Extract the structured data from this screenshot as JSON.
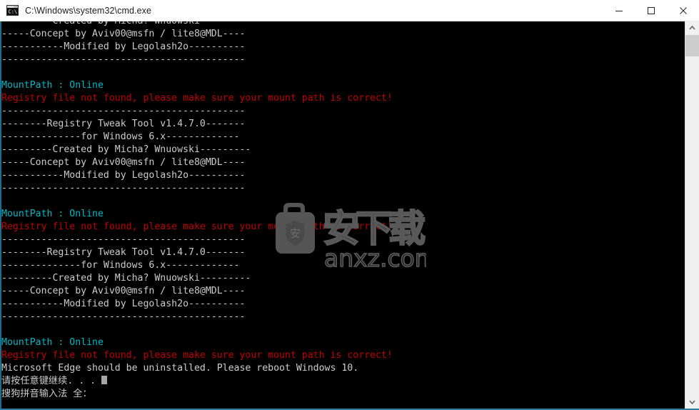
{
  "window": {
    "title": "C:\\Windows\\system32\\cmd.exe",
    "icon": "cmd-console-icon",
    "minimize_label": "—",
    "maximize_label": "□",
    "close_label": "✕"
  },
  "console": {
    "foreground_color": "#cccccc",
    "background_color": "#000000",
    "cyan_color": "#00b7c3",
    "red_color": "#c00000",
    "lines": [
      {
        "text": "---------Created by Micha? Wnuowski---------",
        "color": "white"
      },
      {
        "text": "-----Concept by Aviv00@msfn / lite8@MDL----",
        "color": "white"
      },
      {
        "text": "-----------Modified by Legolash2o----------",
        "color": "white"
      },
      {
        "text": "-------------------------------------------",
        "color": "white"
      },
      {
        "text": "",
        "color": "white"
      },
      {
        "text": "MountPath : Online",
        "color": "cyan"
      },
      {
        "text": "Registry file not found, please make sure your mount path is correct!",
        "color": "red"
      },
      {
        "text": "-------------------------------------------",
        "color": "white"
      },
      {
        "text": "--------Registry Tweak Tool v1.4.7.0-------",
        "color": "white"
      },
      {
        "text": "--------------for Windows 6.x-------------",
        "color": "white"
      },
      {
        "text": "---------Created by Micha? Wnuowski---------",
        "color": "white"
      },
      {
        "text": "-----Concept by Aviv00@msfn / lite8@MDL----",
        "color": "white"
      },
      {
        "text": "-----------Modified by Legolash2o----------",
        "color": "white"
      },
      {
        "text": "-------------------------------------------",
        "color": "white"
      },
      {
        "text": "",
        "color": "white"
      },
      {
        "text": "MountPath : Online",
        "color": "cyan"
      },
      {
        "text": "Registry file not found, please make sure your mount path is correct!",
        "color": "red"
      },
      {
        "text": "-------------------------------------------",
        "color": "white"
      },
      {
        "text": "--------Registry Tweak Tool v1.4.7.0-------",
        "color": "white"
      },
      {
        "text": "--------------for Windows 6.x-------------",
        "color": "white"
      },
      {
        "text": "---------Created by Micha? Wnuowski---------",
        "color": "white"
      },
      {
        "text": "-----Concept by Aviv00@msfn / lite8@MDL----",
        "color": "white"
      },
      {
        "text": "-----------Modified by Legolash2o----------",
        "color": "white"
      },
      {
        "text": "-------------------------------------------",
        "color": "white"
      },
      {
        "text": "",
        "color": "white"
      },
      {
        "text": "MountPath : Online",
        "color": "cyan"
      },
      {
        "text": "Registry file not found, please make sure your mount path is correct!",
        "color": "red"
      },
      {
        "text": "Microsoft Edge should be uninstalled. Please reboot Windows 10.",
        "color": "white"
      }
    ],
    "prompt_line": "请按任意键继续. . . ",
    "ime_line": "搜狗拼音输入法 全："
  },
  "watermark": {
    "chinese_text": "安下载",
    "domain_text": "anxz.com",
    "badge_char": "安",
    "color": "#4a4a4a"
  },
  "scrollbar": {
    "up_arrow": "˄",
    "down_arrow": "˅",
    "thumb_label": "scroll-thumb"
  }
}
